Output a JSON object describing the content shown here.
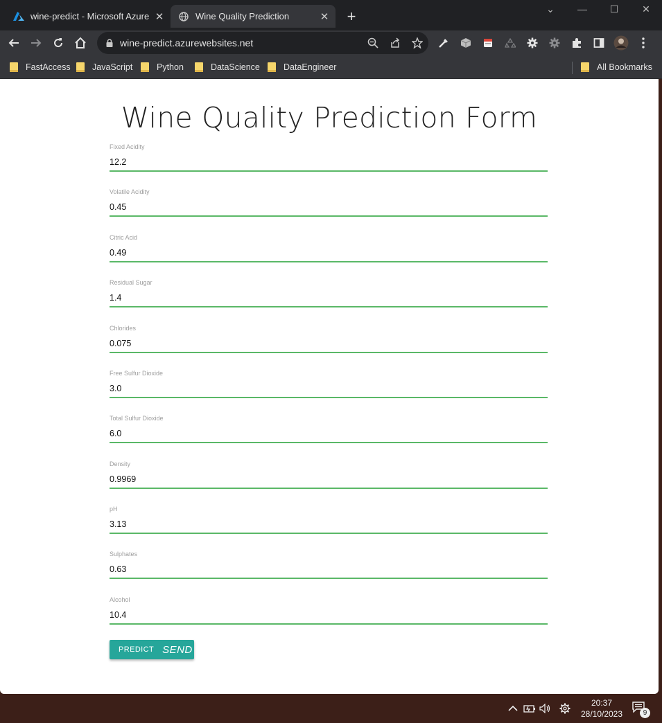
{
  "browser": {
    "tabs": [
      {
        "title": "wine-predict - Microsoft Azure",
        "icon": "azure-logo-icon",
        "active": false
      },
      {
        "title": "Wine Quality Prediction",
        "icon": "globe-icon",
        "active": true
      }
    ],
    "url": "wine-predict.azurewebsites.net",
    "bookmarks": [
      "FastAccess",
      "JavaScript",
      "Python",
      "DataScience",
      "DataEngineer"
    ],
    "all_bookmarks": "All Bookmarks"
  },
  "page": {
    "title": "Wine Quality Prediction Form",
    "fields": [
      {
        "label": "Fixed Acidity",
        "value": "12.2"
      },
      {
        "label": "Volatile Acidity",
        "value": "0.45"
      },
      {
        "label": "Citric Acid",
        "value": "0.49"
      },
      {
        "label": "Residual Sugar",
        "value": "1.4"
      },
      {
        "label": "Chlorides",
        "value": "0.075"
      },
      {
        "label": "Free Sulfur Dioxide",
        "value": "3.0"
      },
      {
        "label": "Total Sulfur Dioxide",
        "value": "6.0"
      },
      {
        "label": "Density",
        "value": "0.9969"
      },
      {
        "label": "pH",
        "value": "3.13"
      },
      {
        "label": "Sulphates",
        "value": "0.63"
      },
      {
        "label": "Alcohol",
        "value": "10.4"
      }
    ],
    "button": {
      "label": "PREDICT",
      "icon_text": "SEND"
    }
  },
  "taskbar": {
    "time": "20:37",
    "date": "28/10/2023",
    "notification_count": "9"
  },
  "colors": {
    "accent_line": "#5ab867",
    "button": "#26a69a",
    "chrome_dark": "#202124",
    "chrome_toolbar": "#35363a",
    "taskbar": "#3c1f18"
  }
}
